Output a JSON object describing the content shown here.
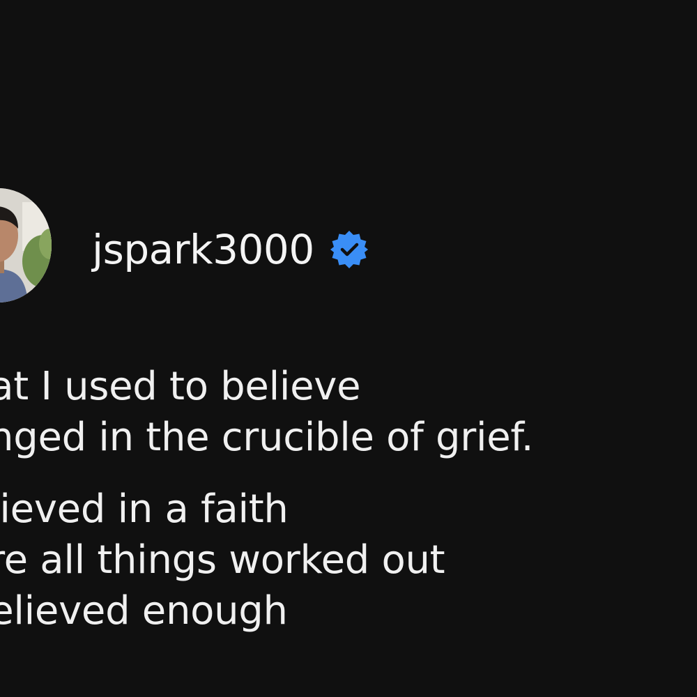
{
  "post": {
    "author": {
      "username": "jspark3000",
      "verified": true,
      "avatar_icon": "profile-photo",
      "verified_icon": "verified-badge-icon",
      "verified_color": "#3a8ef6"
    },
    "paragraphs": [
      {
        "lines": [
          "hat I used to believe",
          "anged in the crucible of grief."
        ]
      },
      {
        "lines": [
          "elieved in a faith",
          "ere all things worked out",
          "believed enough"
        ]
      }
    ]
  },
  "colors": {
    "background": "#101010",
    "text": "#f0f0f0"
  }
}
